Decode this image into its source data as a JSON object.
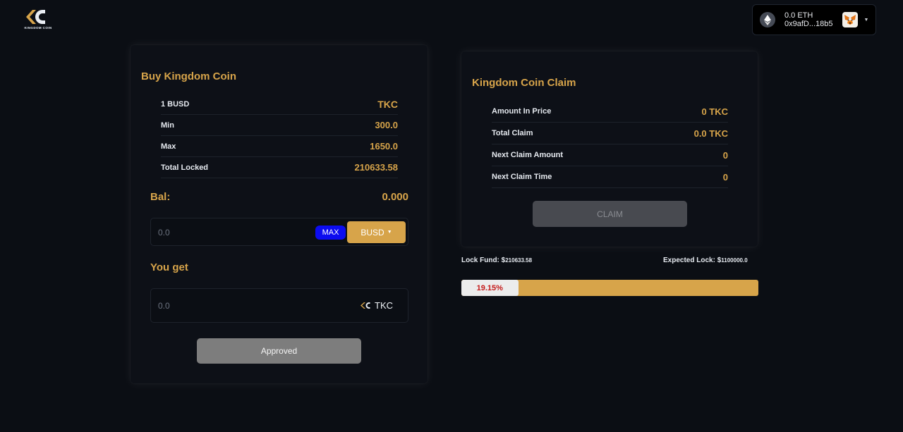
{
  "header": {
    "logo_text": "KINGDOM COIN",
    "wallet": {
      "balance": "0.0 ETH",
      "address": "0x9afD...18b5",
      "eth_icon": "eth-icon",
      "wallet_icon": "metamask-fox-icon"
    }
  },
  "buy": {
    "title": "Buy Kingdom Coin",
    "rows": [
      {
        "label": "1 BUSD",
        "value": "TKC"
      },
      {
        "label": "Min",
        "value": "300.0"
      },
      {
        "label": "Max",
        "value": "1650.0"
      },
      {
        "label": "Total Locked",
        "value": "210633.58"
      }
    ],
    "balance_label": "Bal:",
    "balance_value": "0.000",
    "pay_value": "0.0",
    "max_label": "MAX",
    "currency_label": "BUSD",
    "you_get_label": "You get",
    "get_value": "0.0",
    "get_currency": "TKC",
    "approved_label": "Approved"
  },
  "claim": {
    "title": "Kingdom Coin Claim",
    "rows": [
      {
        "label": "Amount In Price",
        "value": "0 TKC"
      },
      {
        "label": "Total Claim",
        "value": "0.0 TKC"
      },
      {
        "label": "Next Claim Amount",
        "value": "0"
      },
      {
        "label": "Next Claim Time",
        "value": "0"
      }
    ],
    "claim_label": "CLAIM"
  },
  "lock": {
    "fund_label": "Lock Fund: ",
    "fund_currency": "$",
    "fund_value": "210633.58",
    "expected_label": "Expected Lock: ",
    "expected_currency": "$",
    "expected_value": "1100000.0",
    "progress_label": "19.15%",
    "progress_percent": 19.15
  },
  "colors": {
    "accent": "#d7a44a",
    "background": "#0b0e14",
    "max_button": "#0c0cf0",
    "progress_text": "#c41a1a"
  }
}
